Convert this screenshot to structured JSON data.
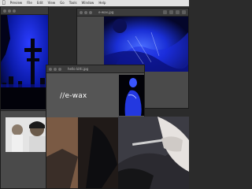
{
  "menubar": {
    "items": [
      "Preview",
      "File",
      "Edit",
      "View",
      "Go",
      "Tools",
      "Window",
      "Help"
    ]
  },
  "windows": {
    "top_left": {
      "title": ""
    },
    "top_right": {
      "title": "e-wax.jpg"
    },
    "middle": {
      "title": "hello kitti.jpg",
      "label": "//e-wax"
    }
  },
  "colors": {
    "accent_blue": "#1030ff",
    "window_bg": "#4a4a4a",
    "desktop": "#2b2b2b"
  }
}
